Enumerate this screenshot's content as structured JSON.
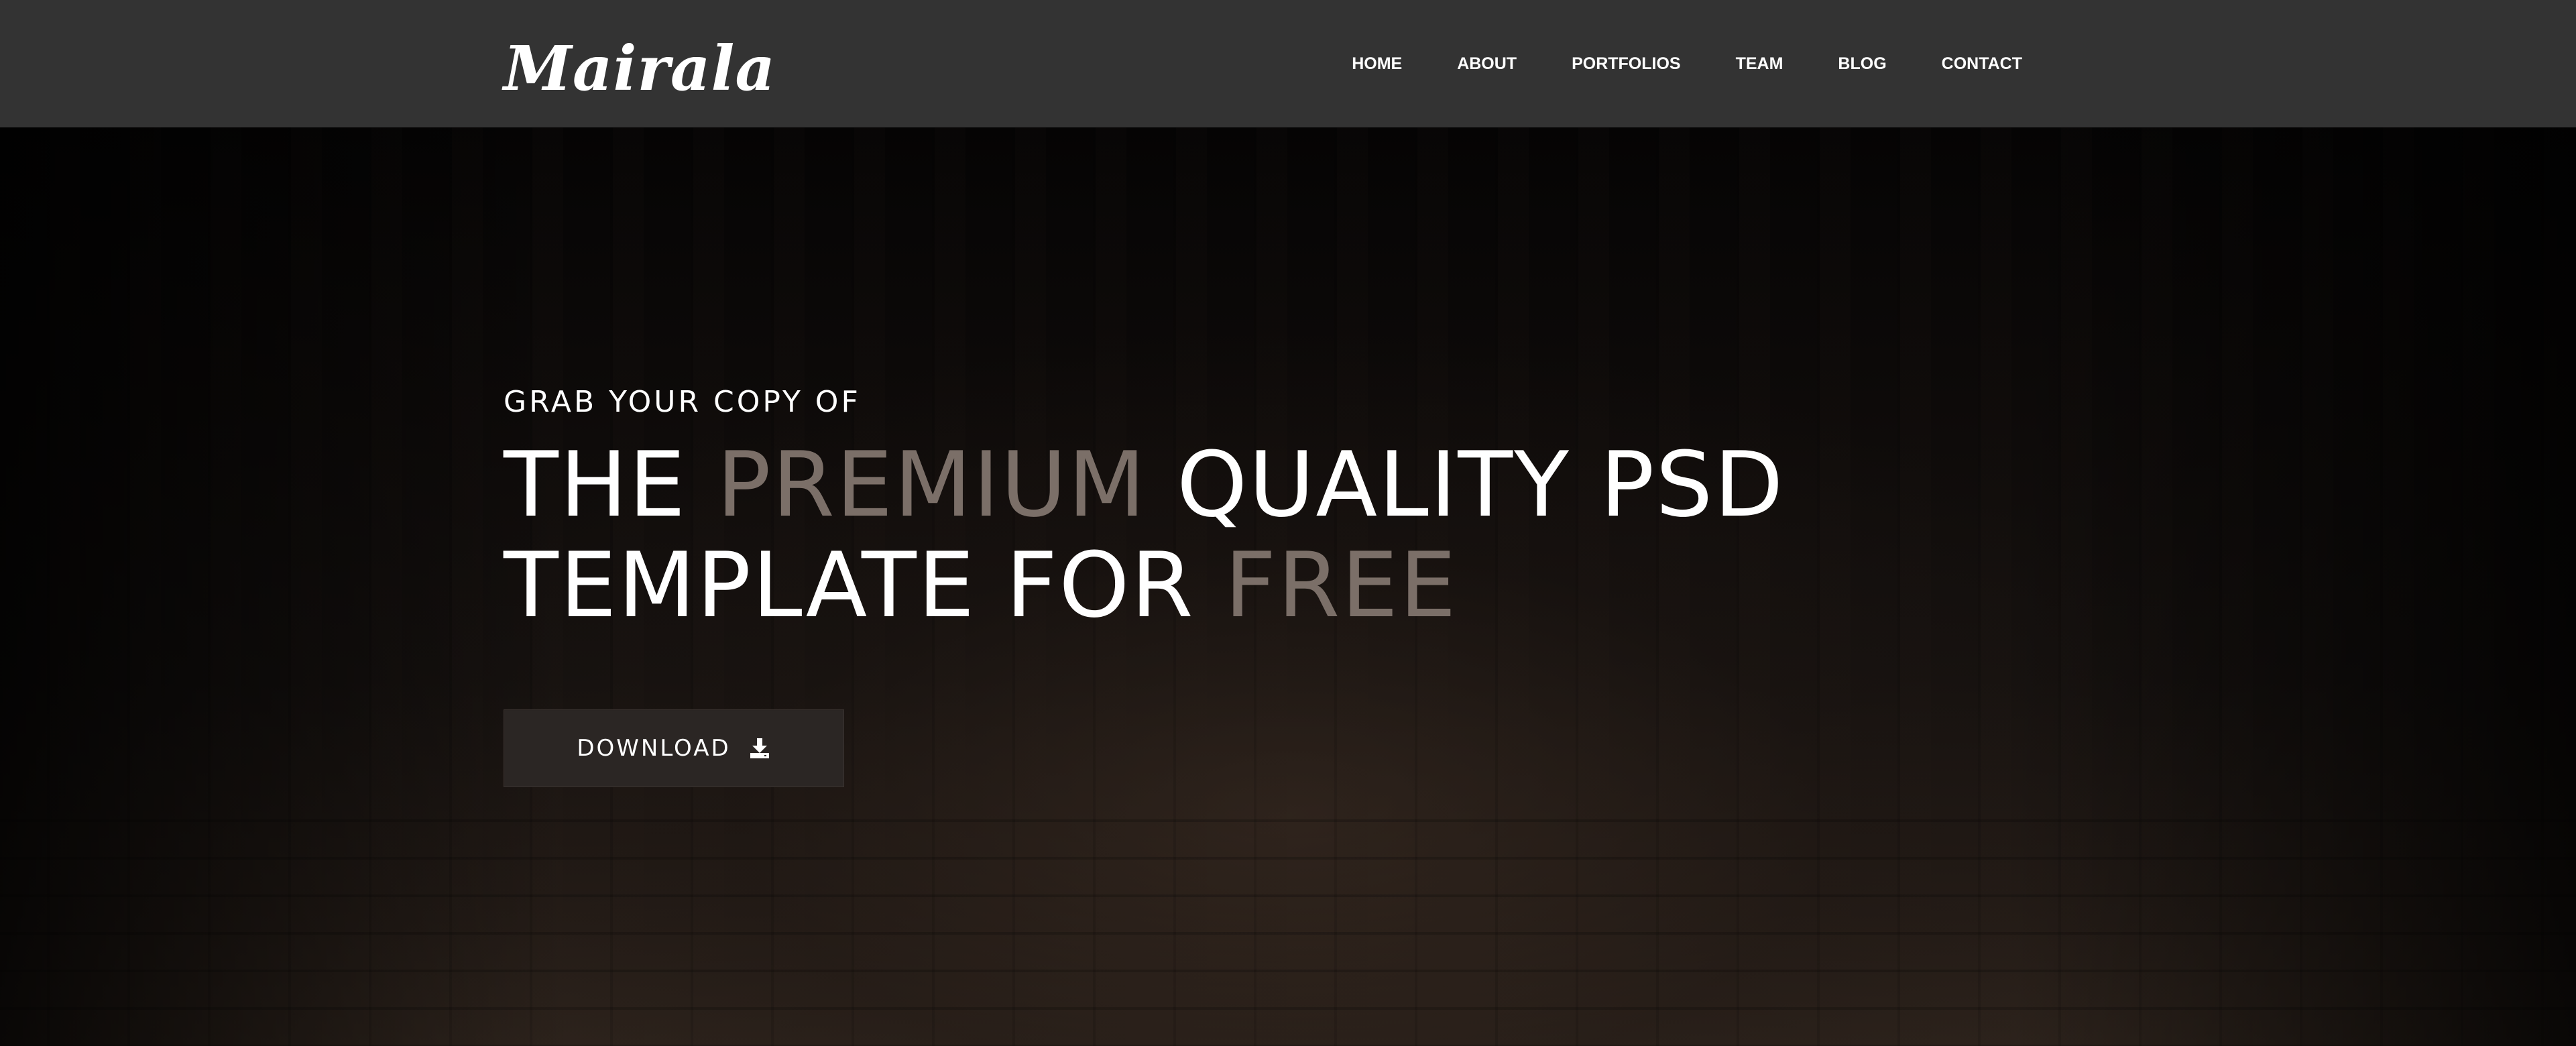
{
  "header": {
    "logo_text": "Mairala",
    "nav": [
      {
        "label": "HOME"
      },
      {
        "label": "ABOUT"
      },
      {
        "label": "PORTFOLIOS"
      },
      {
        "label": "TEAM"
      },
      {
        "label": "BLOG"
      },
      {
        "label": "CONTACT"
      }
    ]
  },
  "hero": {
    "kicker": "GRAB YOUR COPY OF",
    "headline": {
      "line1_part1": "THE ",
      "line1_accent": "PREMIUM",
      "line1_part2": " QUALITY PSD",
      "line2_part1": "TEMPLATE FOR ",
      "line2_accent": "FREE"
    },
    "download_label": "DOWNLOAD",
    "download_icon": "download-icon"
  },
  "colors": {
    "header_bg": "#333333",
    "accent_text": "#7b6f68",
    "button_bg": "#2b2624",
    "text": "#ffffff"
  }
}
